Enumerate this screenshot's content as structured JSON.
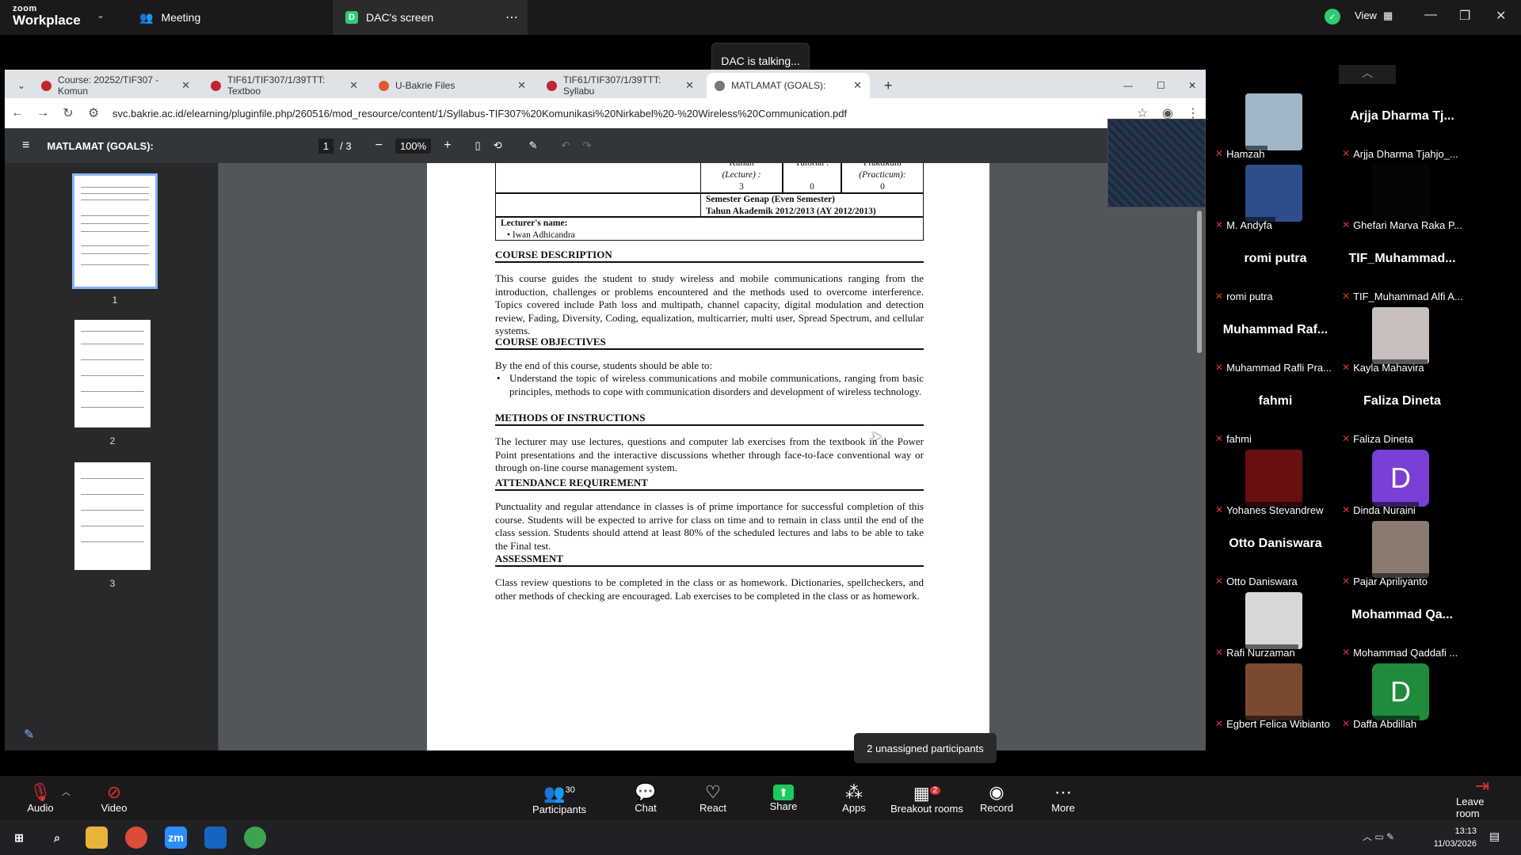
{
  "zoom": {
    "brand_top": "zoom",
    "brand_bottom": "Workplace",
    "meeting_tab": "Meeting",
    "share_tab": "DAC's screen",
    "share_badge": "D",
    "view_label": "View",
    "talking_toast": "DAC is talking...",
    "unassigned": "2 unassigned participants"
  },
  "browser": {
    "tabs": [
      {
        "label": "Course: 20252/TIF307 - Komun"
      },
      {
        "label": "TIF61/TIF307/1/39TTT: Textboo"
      },
      {
        "label": "U-Bakrie Files"
      },
      {
        "label": "TIF61/TIF307/1/39TTT: Syllabu"
      },
      {
        "label": "MATLAMAT (GOALS):"
      }
    ],
    "url": "svc.bakrie.ac.id/elearning/pluginfile.php/260516/mod_resource/content/1/Syllabus-TIF307%20Komunikasi%20Nirkabel%20-%20Wireless%20Communication.pdf"
  },
  "pdf": {
    "title": "MATLAMAT (GOALS):",
    "page_current": "1",
    "page_total": "/ 3",
    "zoom": "100%",
    "thumb_labels": [
      "1",
      "2",
      "3"
    ],
    "table": {
      "kuliah": "Kuliah",
      "lecture": "(Lecture) :",
      "kuliah_val": "3",
      "tutorial": "Tutorial :",
      "tutorial_val": "0",
      "praktikum": "Praktikum",
      "practicum": "(Practicum):",
      "praktikum_val": "0",
      "semester": "Semester Genap (Even Semester)",
      "tahun": "Tahun Akademik 2012/2013 (AY 2012/2013)",
      "lecturer_label": "Lecturer's name:",
      "lecturer": "Iwan Adhicandra"
    },
    "sections": [
      {
        "heading": "COURSE DESCRIPTION",
        "text": "This course guides the student to study wireless and mobile communications ranging from the introduction, challenges or problems encountered and the methods used to overcome interference. Topics covered include Path loss and multipath, channel capacity, digital modulation and detection review, Fading, Diversity, Coding, equalization, multicarrier, multi user, Spread Spectrum, and cellular systems."
      },
      {
        "heading": "COURSE OBJECTIVES",
        "text": "By the end of this course, students should be able to:",
        "bullet": "Understand the topic of wireless communications and mobile communications, ranging from basic principles, methods to cope with communication disorders and development of wireless technology."
      },
      {
        "heading": "METHODS OF INSTRUCTIONS",
        "text": "The lecturer may use lectures, questions and computer lab exercises from the textbook in the Power Point presentations and the interactive discussions whether through face-to-face conventional way or through on-line course management system."
      },
      {
        "heading": "ATTENDANCE REQUIREMENT",
        "text": "Punctuality and regular attendance in classes is of prime importance for successful completion of this course. Students will be expected to arrive for class on time and to remain in class until the end of the class session. Students should attend at least 80% of the scheduled lectures and labs to be able to take the Final test."
      },
      {
        "heading": "ASSESSMENT",
        "text": "Class review questions to be completed in the class or as homework. Dictionaries, spellcheckers, and other methods of checking are encouraged. Lab exercises to be completed in the class or as homework."
      }
    ]
  },
  "participants": [
    {
      "big": "",
      "small": "Hamzah",
      "kind": "img",
      "color": "#9fb6c9"
    },
    {
      "big": "Arjja Dharma Tj...",
      "small": "Arjja Dharma Tjahjo_...",
      "kind": "name"
    },
    {
      "big": "",
      "small": "M. Andyfa",
      "kind": "img",
      "color": "#2d4e8c"
    },
    {
      "big": "",
      "small": "Ghefari Marva Raka P...",
      "kind": "img",
      "color": "#050505"
    },
    {
      "big": "romi putra",
      "small": "romi putra",
      "kind": "name"
    },
    {
      "big": "TIF_Muhammad...",
      "small": "TIF_Muhammad Alfi A...",
      "kind": "name"
    },
    {
      "big": "Muhammad Raf...",
      "small": "Muhammad Rafli Pra...",
      "kind": "name"
    },
    {
      "big": "",
      "small": "Kayla Mahavira",
      "kind": "img",
      "color": "#c8c0bc"
    },
    {
      "big": "fahmi",
      "small": "fahmi",
      "kind": "name"
    },
    {
      "big": "Faliza Dineta",
      "small": "Faliza Dineta",
      "kind": "name"
    },
    {
      "big": "",
      "small": "Yohanes Stevandrew",
      "kind": "img",
      "color": "#6a0f10"
    },
    {
      "big": "D",
      "small": "Dinda Nuraini",
      "kind": "letter",
      "color": "#7a3fd6"
    },
    {
      "big": "Otto Daniswara",
      "small": "Otto Daniswara",
      "kind": "name"
    },
    {
      "big": "",
      "small": "Pajar Apriliyanto",
      "kind": "img",
      "color": "#8a7b70"
    },
    {
      "big": "",
      "small": "Rafi Nurzaman",
      "kind": "img",
      "color": "#d8d8d8"
    },
    {
      "big": "Mohammad Qa...",
      "small": "Mohammad Qaddafi ...",
      "kind": "name"
    },
    {
      "big": "",
      "small": "Egbert Felica Wibianto",
      "kind": "img",
      "color": "#7a4a2e"
    },
    {
      "big": "D",
      "small": "Daffa Abdillah",
      "kind": "letter",
      "color": "#1f8b3b"
    }
  ],
  "toolbar": {
    "audio": "Audio",
    "video": "Video",
    "participants": "Participants",
    "participants_count": "30",
    "chat": "Chat",
    "react": "React",
    "share": "Share",
    "apps": "Apps",
    "breakout": "Breakout rooms",
    "breakout_badge": "2",
    "record": "Record",
    "more": "More",
    "leave": "Leave room"
  },
  "taskbar": {
    "time": "13:13",
    "date": "11/03/2026"
  },
  "colors": {
    "accent_green": "#2ecc71",
    "mute_red": "#e03131",
    "share_green": "#1ec760"
  }
}
